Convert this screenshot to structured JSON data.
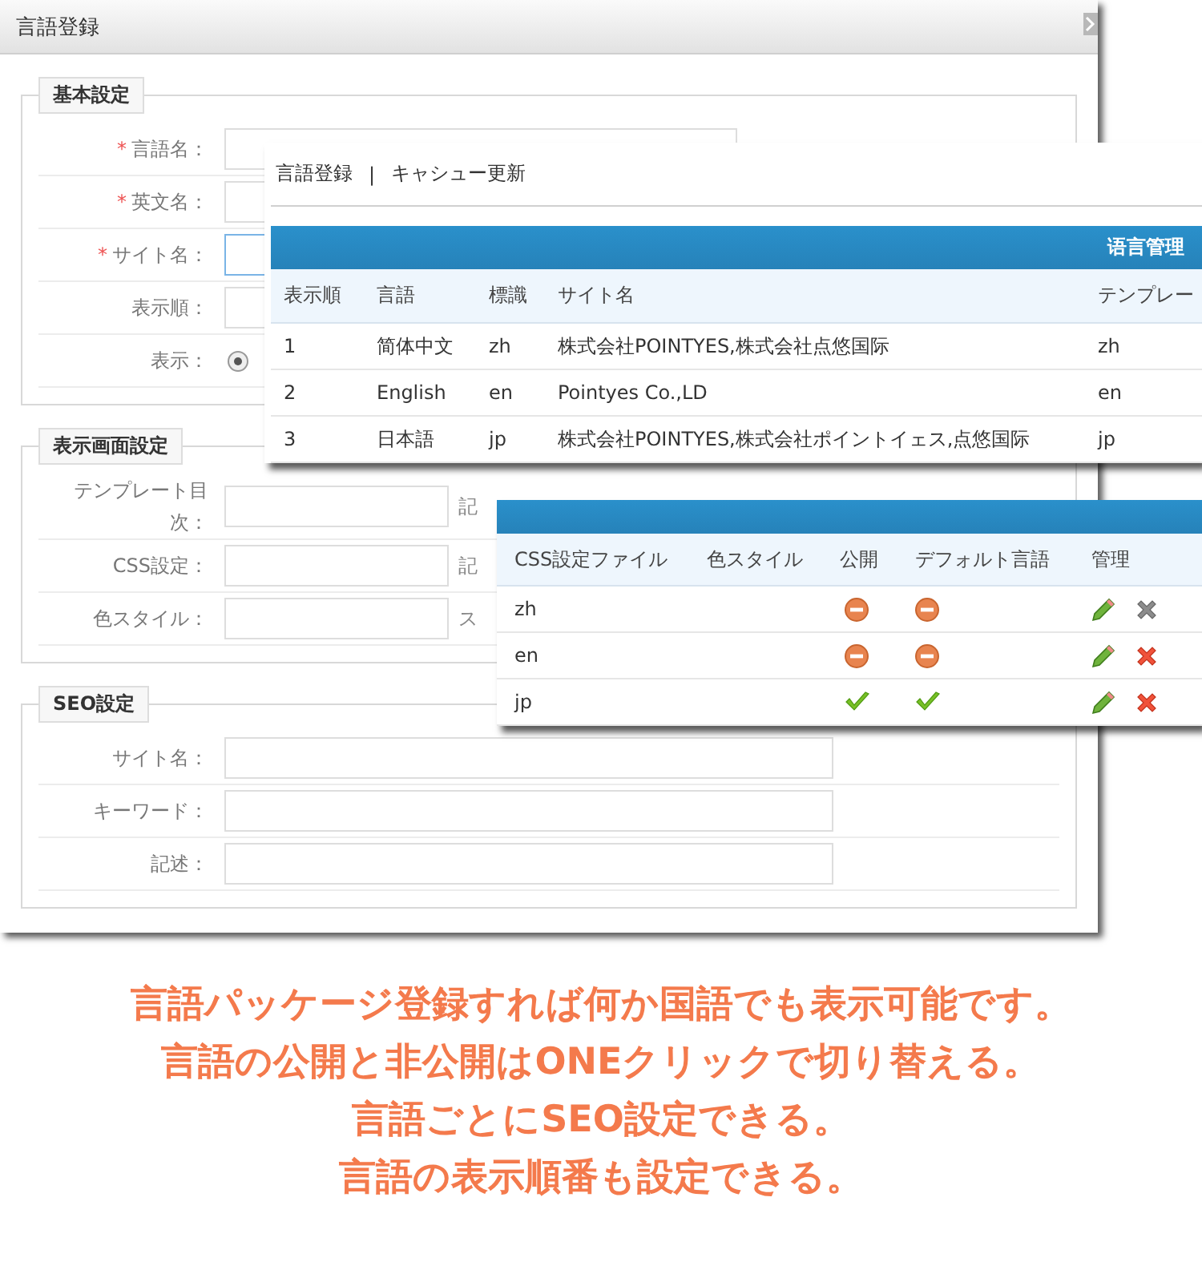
{
  "form": {
    "title": "言語登録",
    "required_mark": "*",
    "sections": [
      {
        "legend": "基本設定",
        "rows": [
          {
            "kind": "input",
            "label": "言語名：",
            "required": true,
            "focused": false
          },
          {
            "kind": "input",
            "label": "英文名：",
            "required": true,
            "focused": false
          },
          {
            "kind": "input",
            "label": "サイト名：",
            "required": true,
            "focused": true
          },
          {
            "kind": "input",
            "label": "表示順：",
            "required": false,
            "focused": false
          },
          {
            "kind": "radio",
            "label": "表示：",
            "checked": true
          }
        ]
      },
      {
        "legend": "表示画面設定",
        "rows": [
          {
            "kind": "input",
            "label": "テンプレート目次：",
            "hint": "記"
          },
          {
            "kind": "input",
            "label": "CSS設定：",
            "hint": "記"
          },
          {
            "kind": "input",
            "label": "色スタイル：",
            "hint": "ス"
          }
        ]
      },
      {
        "legend": "SEO設定",
        "rows": [
          {
            "kind": "wide",
            "label": "サイト名："
          },
          {
            "kind": "wide",
            "label": "キーワード："
          },
          {
            "kind": "wide",
            "label": "記述："
          }
        ]
      }
    ]
  },
  "language_list": {
    "links": [
      "言語登録",
      "キャシュー更新"
    ],
    "separator": "|",
    "banner": "语言管理",
    "columns": [
      "表示順",
      "言語",
      "標識",
      "サイト名",
      "テンプレー"
    ],
    "rows": [
      [
        "1",
        "简体中文",
        "zh",
        "株式会社POINTYES,株式会社点悠国际",
        "zh"
      ],
      [
        "2",
        "English",
        "en",
        "Pointyes Co.,LD",
        "en"
      ],
      [
        "3",
        "日本語",
        "jp",
        "株式会社POINTYES,株式会社ポイントイェス,点悠国际",
        "jp"
      ]
    ]
  },
  "language_settings": {
    "columns": [
      "CSS設定ファイル",
      "色スタイル",
      "公開",
      "デフォルト言語",
      "管理"
    ],
    "rows": [
      {
        "css_file": "zh",
        "public": false,
        "default": false,
        "deletable": false
      },
      {
        "css_file": "en",
        "public": false,
        "default": false,
        "deletable": true
      },
      {
        "css_file": "jp",
        "public": true,
        "default": true,
        "deletable": true
      }
    ]
  },
  "caption": [
    "言語パッケージ登録すれば何か国語でも表示可能です。",
    "言語の公開と非公開はONEクリックで切り替える。",
    "言語ごとにSEO設定できる。",
    "言語の表示順番も設定できる。"
  ]
}
